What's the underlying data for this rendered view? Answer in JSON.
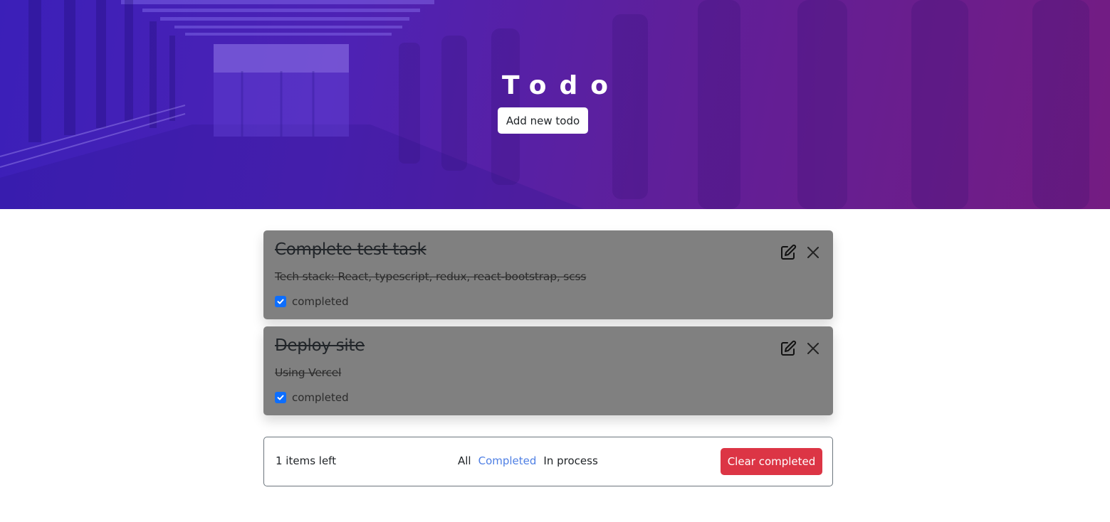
{
  "header": {
    "title": "Todo",
    "add_button_label": "Add new todo"
  },
  "todos": [
    {
      "title": "Complete test task",
      "description": "Tech stack: React, typescript, redux, react-bootstrap, scss",
      "status_label": "completed",
      "checked": true
    },
    {
      "title": "Deploy site",
      "description": "Using Vercel",
      "status_label": "completed",
      "checked": true
    }
  ],
  "footer": {
    "items_left": "1 items left",
    "filters": [
      {
        "label": "All",
        "active": false
      },
      {
        "label": "Completed",
        "active": true
      },
      {
        "label": "In process",
        "active": false
      }
    ],
    "clear_button_label": "Clear completed"
  },
  "colors": {
    "accent": "#0d6efd",
    "active_filter": "#4e7fe4",
    "danger": "#dc3545",
    "card_bg": "#808080"
  },
  "icons": {
    "edit": "pencil-square-icon",
    "close": "close-icon",
    "check": "check-icon"
  }
}
